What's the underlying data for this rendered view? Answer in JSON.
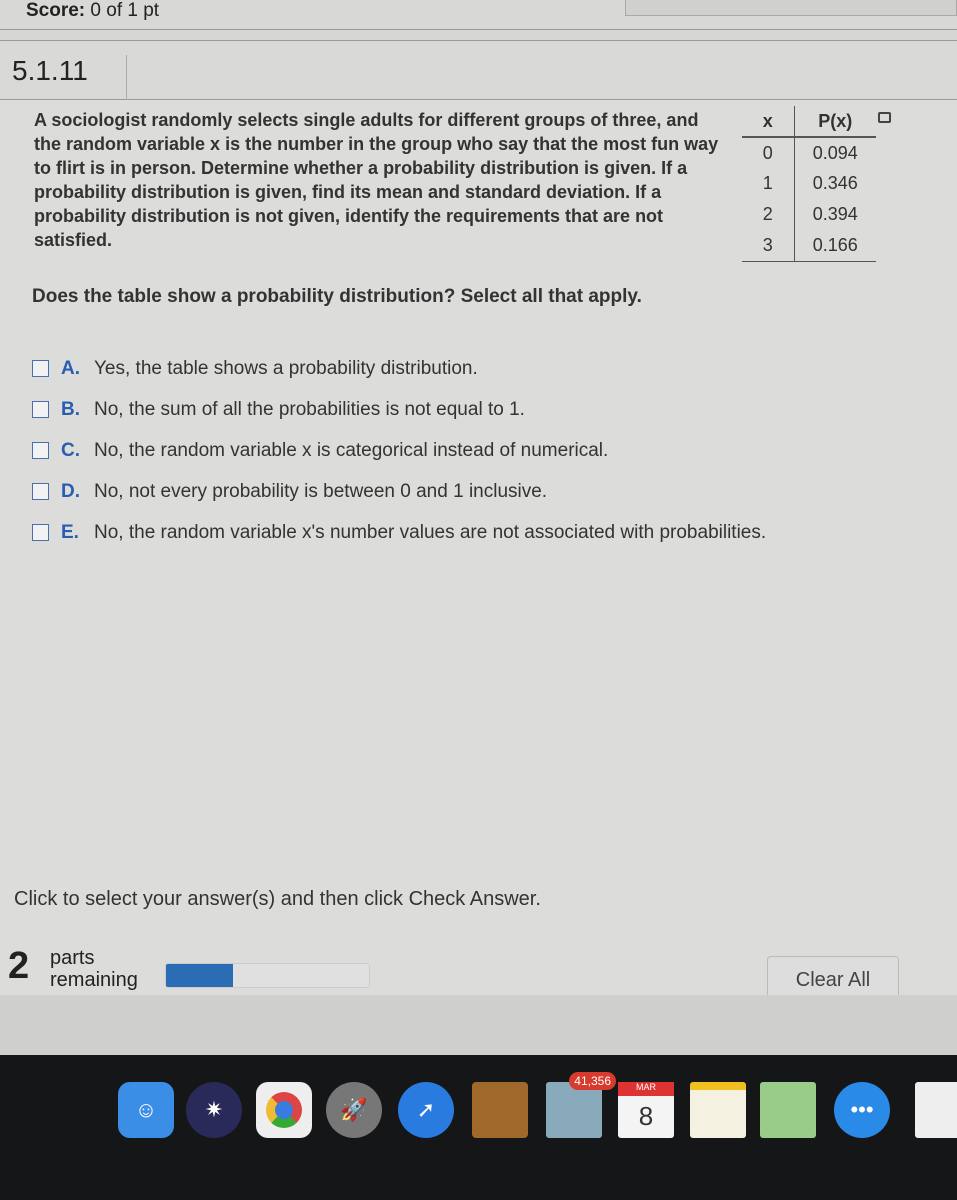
{
  "header": {
    "score_label": "Score:",
    "score_value": "0 of 1 pt"
  },
  "question_id": "5.1.11",
  "prompt": "A sociologist randomly selects single adults for different groups of three, and the random variable x is the number in the group who say that the most fun way to flirt is in person. Determine whether a probability distribution is given. If a probability distribution is given, find its mean and standard deviation. If a probability distribution is not given, identify the requirements that are not satisfied.",
  "table": {
    "headers": [
      "x",
      "P(x)"
    ],
    "rows": [
      [
        "0",
        "0.094"
      ],
      [
        "1",
        "0.346"
      ],
      [
        "2",
        "0.394"
      ],
      [
        "3",
        "0.166"
      ]
    ]
  },
  "question": "Does the table show a probability distribution? Select all that apply.",
  "options": [
    {
      "letter": "A.",
      "text": "Yes, the table shows a probability distribution.",
      "checked": false
    },
    {
      "letter": "B.",
      "text": "No, the sum of all the probabilities is not equal to 1.",
      "checked": false
    },
    {
      "letter": "C.",
      "text": "No, the random variable x is categorical instead of numerical.",
      "checked": false
    },
    {
      "letter": "D.",
      "text": "No, not every probability is between 0 and 1 inclusive.",
      "checked": false
    },
    {
      "letter": "E.",
      "text": "No, the random variable x's number values are not associated with probabilities.",
      "checked": false
    }
  ],
  "instruction": "Click to select your answer(s) and then click Check Answer.",
  "footer": {
    "parts_count": "2",
    "parts_label1": "parts",
    "parts_label2": "remaining",
    "progress_percent": 33,
    "clear_all": "Clear All"
  },
  "colors": {
    "accent": "#2a6db5",
    "letter": "#2a5db0"
  },
  "dock": {
    "mail_badge": "41,356",
    "calendar_month": "MAR",
    "calendar_day": "8"
  }
}
